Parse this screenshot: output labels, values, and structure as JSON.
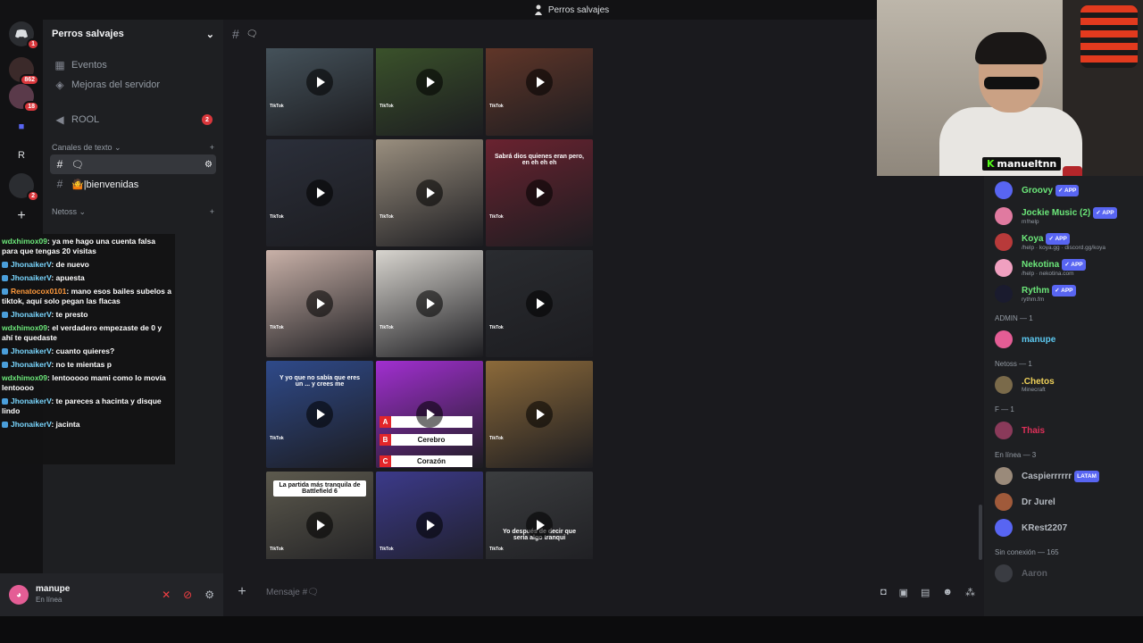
{
  "window": {
    "title": "Perros salvajes"
  },
  "server": {
    "name": "Perros salvajes"
  },
  "guilds": [
    {
      "label": "",
      "badge": "1"
    },
    {
      "label": "",
      "badge": "862"
    },
    {
      "label": "",
      "badge": "18"
    },
    {
      "label": "",
      "badge": ""
    },
    {
      "label": "R",
      "badge": ""
    },
    {
      "label": "",
      "badge": "2"
    },
    {
      "label": "+",
      "badge": ""
    }
  ],
  "sidebar": {
    "events": "Eventos",
    "boosts": "Mejoras del servidor",
    "rool": "ROOL",
    "rool_badge": "2",
    "text_category": "Canales de texto",
    "channel_active": "🗨",
    "channel_welcome": "🤷|bienvenidas",
    "netoss_category": "Netoss"
  },
  "chat_overlay": [
    {
      "user": "wdxhimox09",
      "text": ": ya me hago una cuenta falsa para que tengas 20 visitas",
      "color": "green"
    },
    {
      "user": "JhonaikerV",
      "text": ": de nuevo",
      "color": "blue"
    },
    {
      "user": "JhonaikerV",
      "text": ": apuesta",
      "color": "blue"
    },
    {
      "user": "Renatocox0101",
      "text": ": mano esos bailes subelos a tiktok, aquí solo pegan las flacas",
      "color": "orange"
    },
    {
      "user": "JhonaikerV",
      "text": ": te presto",
      "color": "blue"
    },
    {
      "user": "wdxhimox09",
      "text": ": el verdadero empezaste de 0 y ahí te quedaste",
      "color": "green"
    },
    {
      "user": "JhonaikerV",
      "text": ": cuanto quieres?",
      "color": "blue"
    },
    {
      "user": "JhonaikerV",
      "text": ": no te mientas p",
      "color": "blue"
    },
    {
      "user": "wdxhimox09",
      "text": ": lentooooo mami como lo movía lentoooo",
      "color": "green"
    },
    {
      "user": "JhonaikerV",
      "text": ": te pareces a hacinta y disque lindo",
      "color": "blue"
    },
    {
      "user": "JhonaikerV",
      "text": ": jacinta",
      "color": "blue"
    }
  ],
  "user_panel": {
    "name": "manupe",
    "status": "En línea"
  },
  "channel": {
    "icon_hash": "#",
    "icon_name": "🗨"
  },
  "tiles": [
    {
      "bg": "#4b5a63",
      "tag": "TikTok",
      "caption": ""
    },
    {
      "bg": "#3f5a2c",
      "tag": "TikTok",
      "caption": ""
    },
    {
      "bg": "#6b3a2a",
      "tag": "TikTok",
      "caption": ""
    },
    {
      "bg": "#2b2f3a",
      "tag": "TikTok",
      "caption": ""
    },
    {
      "bg": "#9a8f7f",
      "tag": "TikTok",
      "caption": ""
    },
    {
      "bg": "#6a2330",
      "tag": "TikTok",
      "caption": "Sabrá dios quienes eran pero, en eh eh eh"
    },
    {
      "bg": "#c9b1a8",
      "tag": "TikTok",
      "caption": ""
    },
    {
      "bg": "#d8d5cf",
      "tag": "TikTok",
      "caption": ""
    },
    {
      "bg": "#2a2c30",
      "tag": "TikTok",
      "caption": ""
    },
    {
      "bg": "#2f4a8a",
      "tag": "TikTok",
      "caption": "Y yo que no sabía que eres un ... y crees me"
    },
    {
      "bg": "#a12fd0",
      "tag": "",
      "caption": ""
    },
    {
      "bg": "#8c6a3a",
      "tag": "TikTok",
      "caption": ""
    },
    {
      "bg": "#5d5a4e",
      "tag": "TikTok",
      "caption": "La partida más tranquila de Battlefield 6"
    },
    {
      "bg": "#3c3a8a",
      "tag": "TikTok",
      "caption": ""
    },
    {
      "bg": "#3b3d3f",
      "tag": "TikTok",
      "caption": "Yo después de decir que sería algo tranqui"
    }
  ],
  "quiz": {
    "a": "A",
    "b": "B",
    "b_text": "Cerebro",
    "c": "C",
    "c_text": "Corazón"
  },
  "composer": {
    "placeholder": "Mensaje #🗨"
  },
  "members": {
    "bots": [
      {
        "name": "Groovy",
        "sub": "",
        "badge": "✓ APP",
        "color": "#6ce87a",
        "av": "#5865f2"
      },
      {
        "name": "Jockie Music (2)",
        "sub": "m!help",
        "badge": "✓ APP",
        "color": "#6ce87a",
        "av": "#e07aa0"
      },
      {
        "name": "Koya",
        "sub": "/help · koya.gg · discord.gg/koya",
        "badge": "✓ APP",
        "color": "#6ce87a",
        "av": "#b83a3a"
      },
      {
        "name": "Nekotina",
        "sub": "/help · nekotina.com",
        "badge": "✓ APP",
        "color": "#6ce87a",
        "av": "#f0a0c0"
      },
      {
        "name": "Rythm",
        "sub": "rythm.fm",
        "badge": "✓ APP",
        "color": "#6ce87a",
        "av": "#1a1b2e"
      }
    ],
    "admin_header": "ADMIN — 1",
    "admin": {
      "name": "manupe",
      "color": "#5cc8f0"
    },
    "netoss_header": "Netoss — 1",
    "netoss": {
      "name": ".Chetos",
      "sub": "Minecraft",
      "color": "#f0d25a"
    },
    "f_header": "F — 1",
    "f": {
      "name": "Thais",
      "color": "#e0305a"
    },
    "online_header": "En línea — 3",
    "online": [
      {
        "name": "Caspierrrrrr",
        "tag": "LATAM"
      },
      {
        "name": "Dr Jurel",
        "tag": ""
      },
      {
        "name": "KRest2207",
        "tag": ""
      }
    ],
    "offline_header": "Sin conexión — 165",
    "offline": [
      {
        "name": "Aaron"
      }
    ]
  },
  "webcam": {
    "handle": "manueltnn"
  }
}
